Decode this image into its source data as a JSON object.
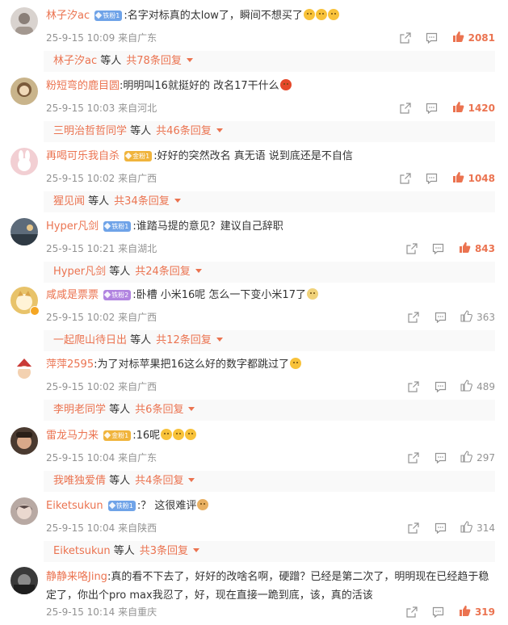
{
  "comments": [
    {
      "username": "林子汐ac",
      "badge": "铁粉1",
      "badge_type": "blue",
      "text": ":名字对标真的太low了，瞬间不想买了",
      "emojis": [
        "",
        "",
        ""
      ],
      "date": "25-9-15 10:09",
      "location": "来自广东",
      "likes": "2081",
      "hot": true,
      "reply_name": "林子汐ac",
      "reply_mid": "等人",
      "reply_total": "共78条回复",
      "avatar_color": "#d9d3cf"
    },
    {
      "username": "粉短弯的鹿目圆",
      "badge": "",
      "badge_type": "",
      "text": ":明明叫16就挺好的 改名17干什么",
      "emojis": [
        "tomato"
      ],
      "date": "25-9-15 10:03",
      "location": "来自河北",
      "likes": "1420",
      "hot": true,
      "reply_name": "三明治哲哲同学",
      "reply_mid": "等人",
      "reply_total": "共46条回复",
      "avatar_color": "#c9b48b"
    },
    {
      "username": "再喝可乐我自杀",
      "badge": "金粉1",
      "badge_type": "gold",
      "text": ":好好的突然改名 真无语 说到底还是不自信",
      "emojis": [],
      "date": "25-9-15 10:02",
      "location": "来自广西",
      "likes": "1048",
      "hot": true,
      "reply_name": "猩见闻",
      "reply_mid": "等人",
      "reply_total": "共34条回复",
      "avatar_color": "#f2cfd3"
    },
    {
      "username": "Hyper凡剑",
      "badge": "铁粉1",
      "badge_type": "blue",
      "text": ":谁踏马提的意见？建议自己辞职",
      "emojis": [],
      "date": "25-9-15 10:21",
      "location": "来自湖北",
      "likes": "843",
      "hot": true,
      "reply_name": "Hyper凡剑",
      "reply_mid": "等人",
      "reply_total": "共24条回复",
      "avatar_color": "#5d6b7a"
    },
    {
      "username": "咸咸是票票",
      "badge": "铁粉2",
      "badge_type": "purple",
      "text": ":卧槽 小米16呢 怎么一下变小米17了",
      "emojis": [
        "cat"
      ],
      "date": "25-9-15 10:02",
      "location": "来自广西",
      "likes": "363",
      "hot": false,
      "reply_name": "一起爬山待日出",
      "reply_mid": "等人",
      "reply_total": "共12条回复",
      "avatar_color": "#e8c36a"
    },
    {
      "username": "萍萍2595",
      "badge": "",
      "badge_type": "",
      "text": ":为了对标苹果把16这么好的数字都跳过了",
      "emojis": [
        ""
      ],
      "date": "25-9-15 10:02",
      "location": "来自广西",
      "likes": "489",
      "hot": false,
      "reply_name": "李明老同学",
      "reply_mid": "等人",
      "reply_total": "共6条回复",
      "avatar_color": "#c93a36"
    },
    {
      "username": "雷龙马力来",
      "badge": "金粉1",
      "badge_type": "gold",
      "text": ":16呢",
      "emojis": [
        "",
        "",
        ""
      ],
      "date": "25-9-15 10:04",
      "location": "来自广东",
      "likes": "297",
      "hot": false,
      "reply_name": "我唯独爱倩",
      "reply_mid": "等人",
      "reply_total": "共4条回复",
      "avatar_color": "#4a3a30"
    },
    {
      "username": "Eiketsukun",
      "badge": "铁粉1",
      "badge_type": "blue",
      "text": ":？ 这很难评",
      "emojis": [
        "dog"
      ],
      "date": "25-9-15 10:04",
      "location": "来自陕西",
      "likes": "314",
      "hot": false,
      "reply_name": "Eiketsukun",
      "reply_mid": "等人",
      "reply_total": "共3条回复",
      "avatar_color": "#b8a9a3"
    },
    {
      "username": "静静来咯Jing",
      "badge": "",
      "badge_type": "",
      "text": ":真的看不下去了，好好的改啥名啊，硬蹭？已经是第二次了，明明现在已经趋于稳定了，你出个pro max我忍了，好，现在直接一跪到底，该，真的活该",
      "emojis": [],
      "date": "25-9-15 10:14",
      "location": "来自重庆",
      "likes": "319",
      "hot": true,
      "reply_name": "",
      "reply_mid": "",
      "reply_total": "",
      "avatar_color": "#3a3a3a"
    }
  ],
  "icons": {
    "share": "share-icon",
    "comment": "comment-icon",
    "like": "like-icon"
  },
  "colors": {
    "accent": "#eb7350",
    "meta": "#939393"
  }
}
